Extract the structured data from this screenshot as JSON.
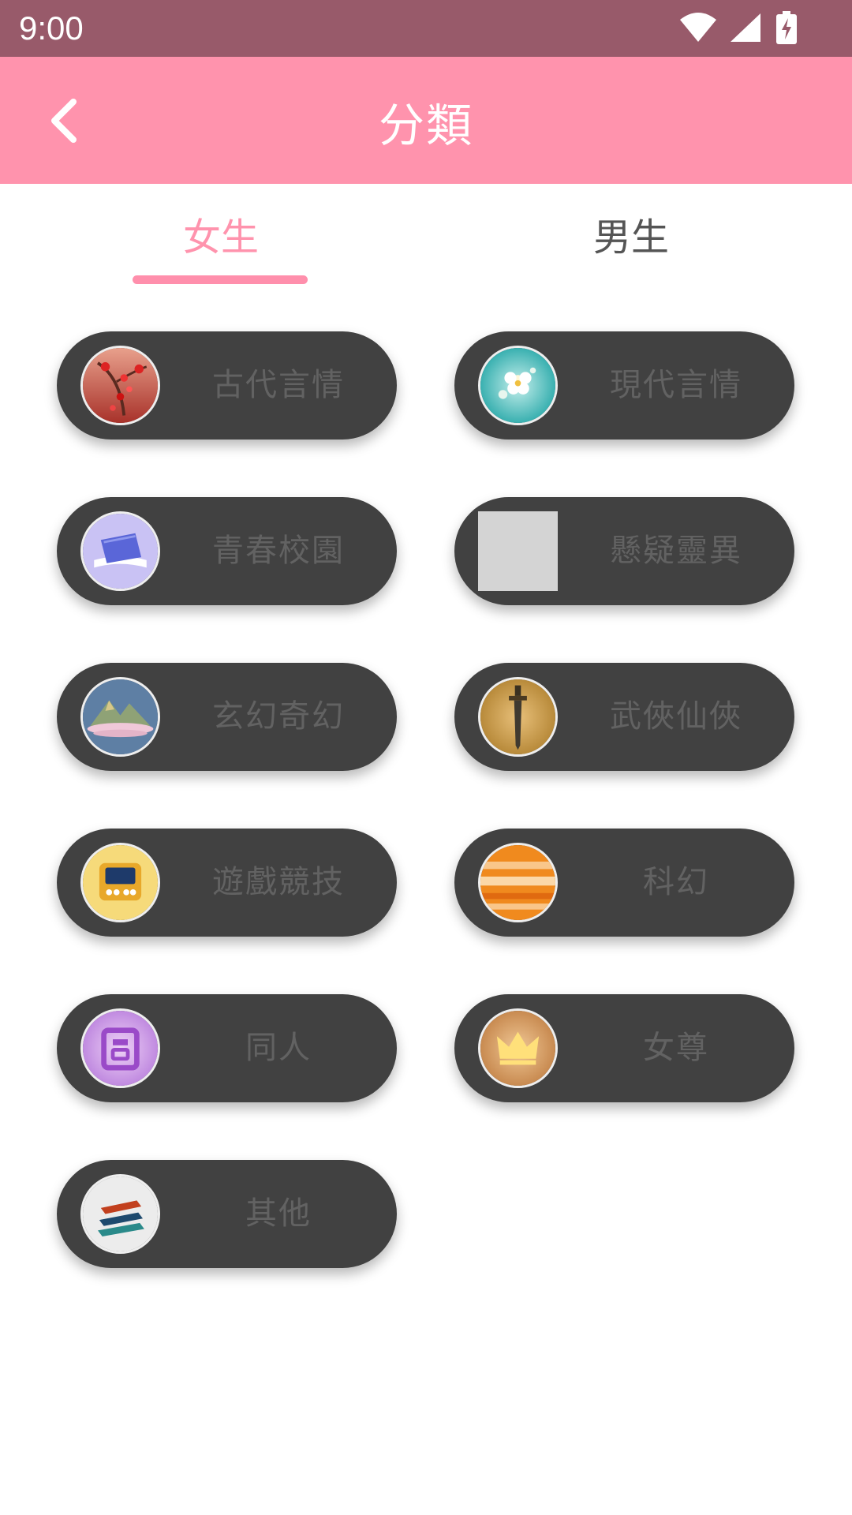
{
  "status_bar": {
    "time": "9:00"
  },
  "header": {
    "title": "分類",
    "back_icon": "chevron-left-icon"
  },
  "tabs": [
    {
      "label": "女生",
      "selected": true
    },
    {
      "label": "男生",
      "selected": false
    }
  ],
  "categories": [
    {
      "label": "古代言情",
      "icon": "plum-blossom-icon"
    },
    {
      "label": "現代言情",
      "icon": "flower-icon"
    },
    {
      "label": "青春校園",
      "icon": "open-book-icon"
    },
    {
      "label": "懸疑靈異",
      "icon": "placeholder-image-icon"
    },
    {
      "label": "玄幻奇幻",
      "icon": "mountain-cloud-icon"
    },
    {
      "label": "武俠仙俠",
      "icon": "sword-icon"
    },
    {
      "label": "遊戲競技",
      "icon": "game-console-icon"
    },
    {
      "label": "科幻",
      "icon": "planet-icon"
    },
    {
      "label": "同人",
      "icon": "tong-character-icon"
    },
    {
      "label": "女尊",
      "icon": "crown-icon"
    },
    {
      "label": "其他",
      "icon": "stacked-books-icon"
    }
  ],
  "colors": {
    "status_bar": "#985a6a",
    "app_bar": "#ff93ad",
    "accent": "#ff93ad",
    "pill_bg": "#414141",
    "pill_text": "#626262"
  }
}
